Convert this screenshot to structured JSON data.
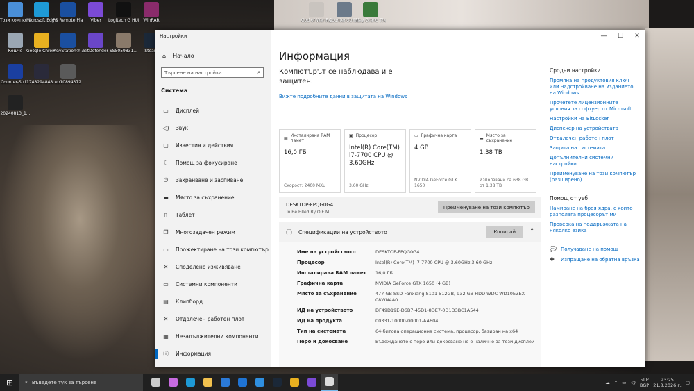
{
  "desktop_icons": [
    {
      "label": "Този компютър",
      "color": "#4a8fd8"
    },
    {
      "label": "Microsoft Edge",
      "color": "#1e9ad6"
    },
    {
      "label": "PS Remote Play",
      "color": "#1a4fa0"
    },
    {
      "label": "Viber",
      "color": "#7b4ad6"
    },
    {
      "label": "Logitech G HUB",
      "color": "#111111"
    },
    {
      "label": "WinRAR",
      "color": "#8a2b6b"
    },
    {
      "label": "Кошче",
      "color": "#9aa6b3"
    },
    {
      "label": "Google Chrome",
      "color": "#e8b020"
    },
    {
      "label": "PlayStation® Accessories",
      "color": "#1a4fa0"
    },
    {
      "label": "BitDefender",
      "color": "#6a46c8"
    },
    {
      "label": "SS5059831...",
      "color": "#8a7a6a"
    },
    {
      "label": "Steam",
      "color": "#1b2838"
    },
    {
      "label": "Counter-Stri...",
      "color": "#1a3fa0"
    },
    {
      "label": "1748294848...",
      "color": "#2a2a3a"
    },
    {
      "label": "ep10894372",
      "color": "#5a5a5a"
    },
    {
      "label": "20240813_1...",
      "color": "#222222"
    },
    {
      "label": "God of War Ragnarok",
      "color": "#c9c4bf"
    },
    {
      "label": "Counter-Strike 1.6 Original",
      "color": "#6c7a8a"
    },
    {
      "label": "Play Grand Theft Auto V",
      "color": "#3a7a3a"
    }
  ],
  "window": {
    "title": "Настройки",
    "home": "Начало",
    "search_placeholder": "Търсене на настройка",
    "section": "Система",
    "nav": [
      {
        "label": "Дисплей",
        "icon": "▭"
      },
      {
        "label": "Звук",
        "icon": "◁)"
      },
      {
        "label": "Известия и действия",
        "icon": "▢"
      },
      {
        "label": "Помощ за фокусиране",
        "icon": "☾"
      },
      {
        "label": "Захранване и заспиване",
        "icon": "⏻"
      },
      {
        "label": "Място за съхранение",
        "icon": "▬"
      },
      {
        "label": "Таблет",
        "icon": "▯"
      },
      {
        "label": "Многозадачен режим",
        "icon": "❐"
      },
      {
        "label": "Прожектиране на този компютър",
        "icon": "▭"
      },
      {
        "label": "Споделено изживяване",
        "icon": "✕"
      },
      {
        "label": "Системни компоненти",
        "icon": "▭"
      },
      {
        "label": "Клипборд",
        "icon": "▤"
      },
      {
        "label": "Отдалечен работен плот",
        "icon": "✕"
      },
      {
        "label": "Незадължителни компоненти",
        "icon": "▦"
      },
      {
        "label": "Информация",
        "icon": "ⓘ"
      }
    ],
    "page_title": "Информация",
    "protection": "Компютърът се наблюдава и е защитен.",
    "protection_link": "Вижте подробните данни в защитата на Windows",
    "cards": [
      {
        "label": "Инсталирана RAM памет",
        "value": "16,0 ГБ",
        "sub": "Скорост: 2400 MXц"
      },
      {
        "label": "Процесор",
        "value": "Intel(R) Core(TM) i7-7700 CPU @ 3.60GHz",
        "sub": "3.60 GHz"
      },
      {
        "label": "Графична карта",
        "value": "4 GB",
        "sub": "NVIDIA GeForce GTX 1650"
      },
      {
        "label": "Място за съхранение",
        "value": "1.38 TB",
        "sub": "Използвани са 638 GB от 1.38 TB"
      }
    ],
    "device": {
      "name": "DESKTOP-FPQG0G4",
      "sub": "To Be Filled By O.E.M.",
      "rename": "Преименуване на този компютър"
    },
    "specs": {
      "title": "Спецификации на устройството",
      "copy": "Копирай",
      "rows": [
        {
          "k": "Име на устройството",
          "v": "DESKTOP-FPQG0G4"
        },
        {
          "k": "Процесор",
          "v": "Intel(R) Core(TM) i7-7700 CPU @ 3.60GHz   3.60 GHz"
        },
        {
          "k": "Инсталирана RAM памет",
          "v": "16,0 ГБ"
        },
        {
          "k": "Графична карта",
          "v": "NVIDIA GeForce GTX 1650 (4 GB)"
        },
        {
          "k": "Място за съхранение",
          "v": "477 GB SSD Fanxiang S101 512GB, 932 GB HDD WDC WD10EZEX-08WN4A0"
        },
        {
          "k": "ИД на устройството",
          "v": "DF49D19E-D6B7-45D1-8DE7-0D1D3BC1A544"
        },
        {
          "k": "ИД на продукта",
          "v": "00331-10000-00001-AA604"
        },
        {
          "k": "Тип на системата",
          "v": "64-битова операционна система, процесор, базиран на x64"
        },
        {
          "k": "Перо и докосване",
          "v": "Въвеждането с перо или докосване не е налично за този дисплей"
        }
      ]
    },
    "related_title": "Сродни настройки",
    "related": [
      "Промяна на продуктовия ключ или надстройване на изданието на Windows",
      "Прочетете лицензионните условия за софтуер от Microsoft",
      "Настройки на BitLocker",
      "Диспечер на устройствата",
      "Отдалечен работен плот",
      "Защита на системата",
      "Допълнителни системни настройки",
      "Преименуване на този компютър (разширено)"
    ],
    "help_title": "Помощ от уеб",
    "help": [
      "Намиране на броя ядра, с които разполага процесорът ми",
      "Проверка на поддръжката на няколко езика"
    ],
    "get_help": "Получаване на помощ",
    "feedback": "Изпращане на обратна връзка"
  },
  "taskbar": {
    "search_placeholder": "Въведете тук за търсене",
    "apps": [
      {
        "name": "task-view",
        "color": "#cccccc"
      },
      {
        "name": "copilot",
        "color": "#c86be0"
      },
      {
        "name": "edge",
        "color": "#1e9ad6"
      },
      {
        "name": "file-explorer",
        "color": "#f2c14e"
      },
      {
        "name": "store",
        "color": "#2b7ad8"
      },
      {
        "name": "outlook",
        "color": "#1f74d4"
      },
      {
        "name": "mail",
        "color": "#2f8fe0"
      },
      {
        "name": "steam",
        "color": "#1b2838"
      },
      {
        "name": "chrome",
        "color": "#e8b020"
      },
      {
        "name": "viber",
        "color": "#7b4ad6"
      },
      {
        "name": "settings",
        "color": "#dddddd"
      }
    ],
    "lang1": "БГР",
    "lang2": "BGP",
    "time": "23:25",
    "date": "21.8.2026 г."
  }
}
